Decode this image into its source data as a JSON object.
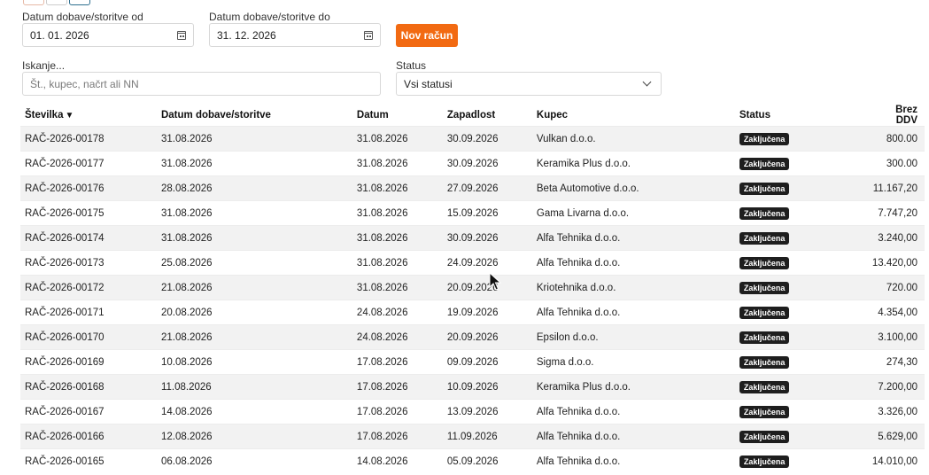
{
  "filters": {
    "date_from_label": "Datum dobave/storitve od",
    "date_from_value": "01. 01. 2026",
    "date_to_label": "Datum dobave/storitve do",
    "date_to_value": "31. 12. 2026",
    "new_invoice_label": "Nov račun",
    "search_label": "Iskanje...",
    "search_placeholder": "Št., kupec, načrt ali NN",
    "status_label": "Status",
    "status_value": "Vsi statusi"
  },
  "table": {
    "columns": [
      "Številka",
      "Datum dobave/storitve",
      "Datum",
      "Zapadlost",
      "Kupec",
      "Status",
      "Brez DDV"
    ],
    "sort_indicator": "▼",
    "rows": [
      [
        "RAČ-2026-00178",
        "31.08.2026",
        "31.08.2026",
        "30.09.2026",
        "Vulkan d.o.o.",
        "Zaključena",
        "800.00"
      ],
      [
        "RAČ-2026-00177",
        "31.08.2026",
        "31.08.2026",
        "30.09.2026",
        "Keramika Plus d.o.o.",
        "Zaključena",
        "300.00"
      ],
      [
        "RAČ-2026-00176",
        "28.08.2026",
        "31.08.2026",
        "27.09.2026",
        "Beta Automotive d.o.o.",
        "Zaključena",
        "11.167,20"
      ],
      [
        "RAČ-2026-00175",
        "31.08.2026",
        "31.08.2026",
        "15.09.2026",
        "Gama Livarna d.o.o.",
        "Zaključena",
        "7.747,20"
      ],
      [
        "RAČ-2026-00174",
        "31.08.2026",
        "31.08.2026",
        "30.09.2026",
        "Alfa Tehnika d.o.o.",
        "Zaključena",
        "3.240,00"
      ],
      [
        "RAČ-2026-00173",
        "25.08.2026",
        "31.08.2026",
        "24.09.2026",
        "Alfa Tehnika d.o.o.",
        "Zaključena",
        "13.420,00"
      ],
      [
        "RAČ-2026-00172",
        "21.08.2026",
        "31.08.2026",
        "20.09.2026",
        "Kriotehnika d.o.o.",
        "Zaključena",
        "720.00"
      ],
      [
        "RAČ-2026-00171",
        "20.08.2026",
        "24.08.2026",
        "19.09.2026",
        "Alfa Tehnika d.o.o.",
        "Zaključena",
        "4.354,00"
      ],
      [
        "RAČ-2026-00170",
        "21.08.2026",
        "24.08.2026",
        "20.09.2026",
        "Epsilon d.o.o.",
        "Zaključena",
        "3.100,00"
      ],
      [
        "RAČ-2026-00169",
        "10.08.2026",
        "17.08.2026",
        "09.09.2026",
        "Sigma d.o.o.",
        "Zaključena",
        "274,30"
      ],
      [
        "RAČ-2026-00168",
        "11.08.2026",
        "17.08.2026",
        "10.09.2026",
        "Keramika Plus d.o.o.",
        "Zaključena",
        "7.200,00"
      ],
      [
        "RAČ-2026-00167",
        "14.08.2026",
        "17.08.2026",
        "13.09.2026",
        "Alfa Tehnika d.o.o.",
        "Zaključena",
        "3.326,00"
      ],
      [
        "RAČ-2026-00166",
        "12.08.2026",
        "17.08.2026",
        "11.09.2026",
        "Alfa Tehnika d.o.o.",
        "Zaključena",
        "5.629,00"
      ],
      [
        "RAČ-2026-00165",
        "06.08.2026",
        "14.08.2026",
        "05.09.2026",
        "Alfa Tehnika d.o.o.",
        "Zaključena",
        "14.010,00"
      ]
    ]
  }
}
